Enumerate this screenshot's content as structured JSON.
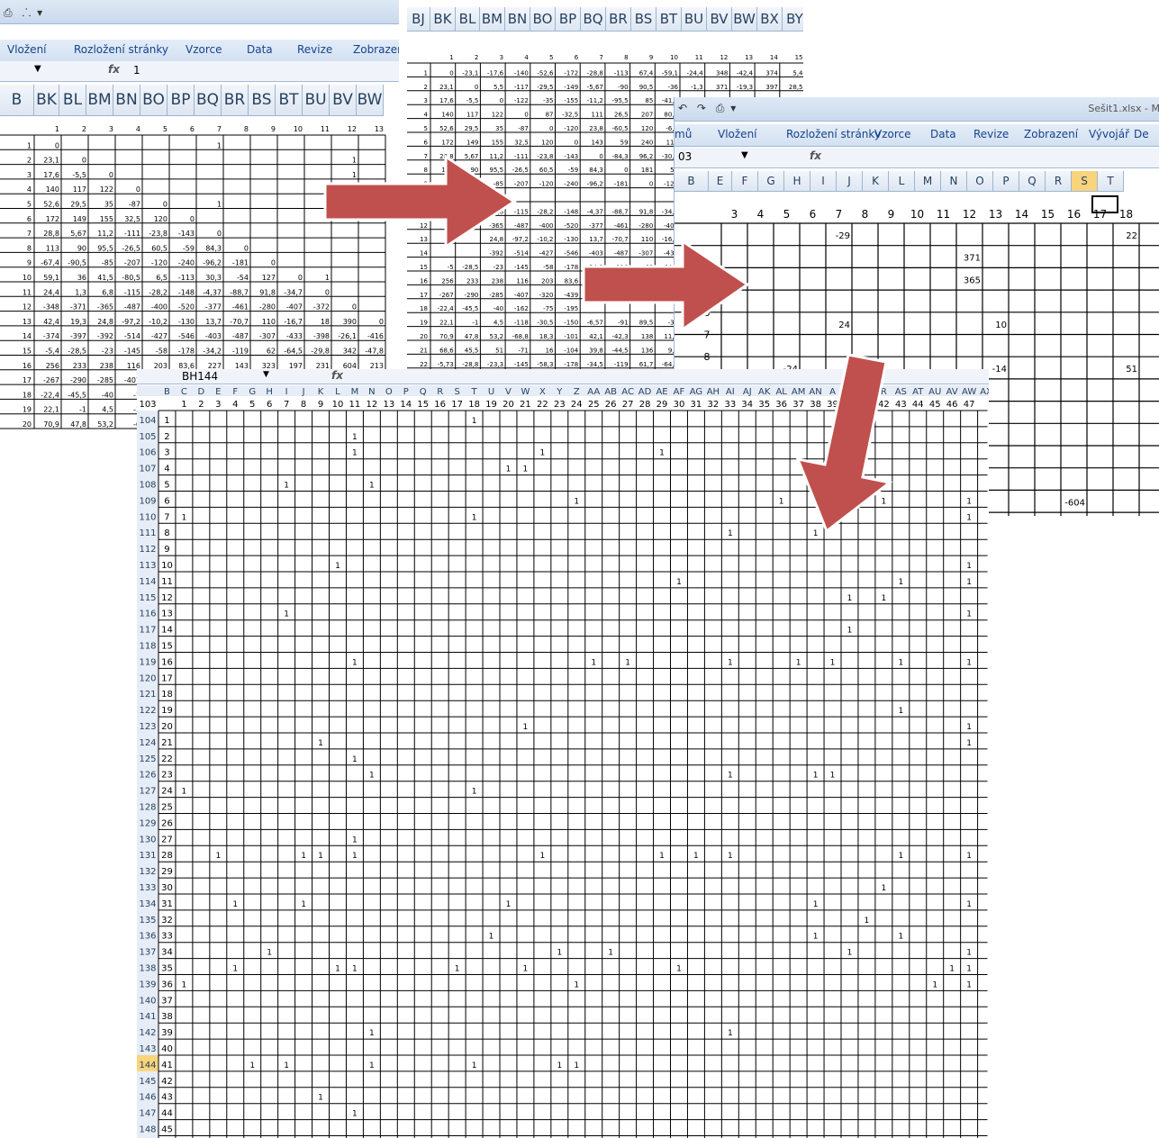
{
  "win_left": {
    "qat_arrow": "▾",
    "tabs": [
      "Vložení",
      "Rozložení stránky",
      "Vzorce",
      "Data",
      "Revize",
      "Zobrazen"
    ],
    "formula_value": "1",
    "fx": "fx",
    "col_headers": [
      "B",
      "BK",
      "BL",
      "BM",
      "BN",
      "BO",
      "BP",
      "BQ",
      "BR",
      "BS",
      "BT",
      "BU",
      "BV",
      "BW"
    ],
    "sub_headers": [
      "1",
      "2",
      "3",
      "4",
      "5",
      "6",
      "7",
      "8",
      "9",
      "10",
      "11",
      "12",
      "13"
    ],
    "rows": [
      {
        "n": "1",
        "v": [
          "0",
          "",
          "",
          "",
          "",
          "",
          "1",
          "",
          "",
          "",
          "",
          "",
          ""
        ]
      },
      {
        "n": "2",
        "v": [
          "23,1",
          "0",
          "",
          "",
          "",
          "",
          "",
          "",
          "",
          "",
          "",
          "1",
          ""
        ]
      },
      {
        "n": "3",
        "v": [
          "17,6",
          "-5,5",
          "0",
          "",
          "",
          "",
          "",
          "",
          "",
          "",
          "",
          "1",
          ""
        ]
      },
      {
        "n": "4",
        "v": [
          "140",
          "117",
          "122",
          "0",
          "",
          "",
          "",
          "",
          "",
          "",
          "",
          "",
          ""
        ]
      },
      {
        "n": "5",
        "v": [
          "52,6",
          "29,5",
          "35",
          "-87",
          "0",
          "",
          "1",
          "",
          "",
          "",
          "",
          "",
          ""
        ]
      },
      {
        "n": "6",
        "v": [
          "172",
          "149",
          "155",
          "32,5",
          "120",
          "0",
          "",
          "",
          "",
          "",
          "",
          "",
          ""
        ]
      },
      {
        "n": "7",
        "v": [
          "28,8",
          "5,67",
          "11,2",
          "-111",
          "-23,8",
          "-143",
          "0",
          "",
          "",
          "",
          "",
          "",
          ""
        ]
      },
      {
        "n": "8",
        "v": [
          "113",
          "90",
          "95,5",
          "-26,5",
          "60,5",
          "-59",
          "84,3",
          "0",
          "",
          "",
          "",
          "",
          ""
        ]
      },
      {
        "n": "9",
        "v": [
          "-67,4",
          "-90,5",
          "-85",
          "-207",
          "-120",
          "-240",
          "-96,2",
          "-181",
          "0",
          "",
          "",
          "",
          ""
        ]
      },
      {
        "n": "10",
        "v": [
          "59,1",
          "36",
          "41,5",
          "-80,5",
          "6,5",
          "-113",
          "30,3",
          "-54",
          "127",
          "0",
          "1",
          "",
          ""
        ]
      },
      {
        "n": "11",
        "v": [
          "24,4",
          "1,3",
          "6,8",
          "-115",
          "-28,2",
          "-148",
          "-4,37",
          "-88,7",
          "91,8",
          "-34,7",
          "0",
          "",
          ""
        ]
      },
      {
        "n": "12",
        "v": [
          "-348",
          "-371",
          "-365",
          "-487",
          "-400",
          "-520",
          "-377",
          "-461",
          "-280",
          "-407",
          "-372",
          "0",
          ""
        ]
      },
      {
        "n": "13",
        "v": [
          "42,4",
          "19,3",
          "24,8",
          "-97,2",
          "-10,2",
          "-130",
          "13,7",
          "-70,7",
          "110",
          "-16,7",
          "18",
          "390",
          "0"
        ]
      },
      {
        "n": "14",
        "v": [
          "-374",
          "-397",
          "-392",
          "-514",
          "-427",
          "-546",
          "-403",
          "-487",
          "-307",
          "-433",
          "-398",
          "-26,1",
          "-416"
        ]
      },
      {
        "n": "15",
        "v": [
          "-5,4",
          "-28,5",
          "-23",
          "-145",
          "-58",
          "-178",
          "-34,2",
          "-119",
          "62",
          "-64,5",
          "-29,8",
          "342",
          "-47,8"
        ]
      },
      {
        "n": "16",
        "v": [
          "256",
          "233",
          "238",
          "116",
          "203",
          "83,6",
          "227",
          "143",
          "323",
          "197",
          "231",
          "604",
          "213"
        ]
      },
      {
        "n": "17",
        "v": [
          "-267",
          "-290",
          "-285",
          "-407",
          "",
          "",
          "",
          "",
          "",
          "",
          "",
          "",
          ""
        ]
      },
      {
        "n": "18",
        "v": [
          "-22,4",
          "-45,5",
          "-40",
          "-1",
          "",
          "",
          "",
          "",
          "",
          "",
          "",
          "",
          ""
        ]
      },
      {
        "n": "19",
        "v": [
          "22,1",
          "-1",
          "4,5",
          "-1",
          "",
          "",
          "",
          "",
          "",
          "",
          "",
          "",
          ""
        ]
      },
      {
        "n": "20",
        "v": [
          "70,9",
          "47,8",
          "53,2",
          "-6",
          "",
          "",
          "",
          "",
          "",
          "",
          "",
          "",
          ""
        ]
      }
    ]
  },
  "win_mid": {
    "col_headers": [
      "BJ",
      "BK",
      "BL",
      "BM",
      "BN",
      "BO",
      "BP",
      "BQ",
      "BR",
      "BS",
      "BT",
      "BU",
      "BV",
      "BW",
      "BX",
      "BY"
    ],
    "sub_headers": [
      "1",
      "2",
      "3",
      "4",
      "5",
      "6",
      "7",
      "8",
      "9",
      "10",
      "11",
      "12",
      "13",
      "14",
      "15"
    ],
    "rows": [
      {
        "n": "1",
        "v": [
          "0",
          "-23,1",
          "-17,6",
          "-140",
          "-52,6",
          "-172",
          "-28,8",
          "-113",
          "67,4",
          "-59,1",
          "-24,4",
          "348",
          "-42,4",
          "374",
          "5,4"
        ]
      },
      {
        "n": "2",
        "v": [
          "23,1",
          "0",
          "5,5",
          "-117",
          "-29,5",
          "-149",
          "-5,67",
          "-90",
          "90,5",
          "-36",
          "-1,3",
          "371",
          "-19,3",
          "397",
          "28,5"
        ]
      },
      {
        "n": "3",
        "v": [
          "17,6",
          "-5,5",
          "0",
          "-122",
          "-35",
          "-155",
          "-11,2",
          "-95,5",
          "85",
          "-41,5",
          "-6,8",
          "365",
          "-24,8",
          "392",
          "23"
        ]
      },
      {
        "n": "4",
        "v": [
          "140",
          "117",
          "122",
          "0",
          "87",
          "-32,5",
          "111",
          "26,5",
          "207",
          "80,5",
          "",
          "",
          "",
          "",
          ""
        ]
      },
      {
        "n": "5",
        "v": [
          "52,6",
          "29,5",
          "35",
          "-87",
          "0",
          "-120",
          "23,8",
          "-60,5",
          "120",
          "-6,5",
          "",
          "",
          "",
          "",
          ""
        ]
      },
      {
        "n": "6",
        "v": [
          "172",
          "149",
          "155",
          "32,5",
          "120",
          "0",
          "143",
          "59",
          "240",
          "113",
          "",
          "",
          "",
          "",
          ""
        ]
      },
      {
        "n": "7",
        "v": [
          "28,8",
          "5,67",
          "11,2",
          "-111",
          "-23,8",
          "-143",
          "0",
          "-84,3",
          "96,2",
          "-30,3",
          "",
          "",
          "",
          "",
          ""
        ]
      },
      {
        "n": "8",
        "v": [
          "113",
          "90",
          "95,5",
          "-26,5",
          "60,5",
          "-59",
          "84,3",
          "0",
          "181",
          "54",
          "",
          "",
          "",
          "",
          ""
        ]
      },
      {
        "n": "9",
        "v": [
          "-67",
          "-90,5",
          "-85",
          "-207",
          "-120",
          "-240",
          "-96,2",
          "-181",
          "0",
          "-127",
          "",
          "",
          "",
          "",
          ""
        ]
      },
      {
        "n": "10",
        "v": [
          "",
          "",
          "",
          "",
          "",
          "",
          "",
          "",
          "",
          "",
          "",
          "",
          "",
          "",
          ""
        ]
      },
      {
        "n": "11",
        "v": [
          "",
          "",
          "6,8",
          "-115",
          "-28,2",
          "-148",
          "-4,37",
          "-88,7",
          "91,8",
          "-34,7",
          "",
          "",
          "",
          "",
          ""
        ]
      },
      {
        "n": "12",
        "v": [
          "",
          "",
          "-365",
          "-487",
          "-400",
          "-520",
          "-377",
          "-461",
          "-280",
          "-407",
          "",
          "",
          "",
          "",
          ""
        ]
      },
      {
        "n": "13",
        "v": [
          "",
          "",
          "24,8",
          "-97,2",
          "-10,2",
          "-130",
          "13,7",
          "-70,7",
          "110",
          "-16,7",
          "",
          "",
          "",
          "",
          ""
        ]
      },
      {
        "n": "14",
        "v": [
          "",
          "",
          "-392",
          "-514",
          "-427",
          "-546",
          "-403",
          "-487",
          "-307",
          "-433",
          "",
          "",
          "",
          "",
          ""
        ]
      },
      {
        "n": "15",
        "v": [
          "-5",
          "-28,5",
          "-23",
          "-145",
          "-58",
          "-178",
          "-34,2",
          "-119",
          "62",
          "-64,5",
          "",
          "",
          "",
          "",
          ""
        ]
      },
      {
        "n": "16",
        "v": [
          "256",
          "233",
          "238",
          "116",
          "203",
          "83,6",
          "",
          "",
          "",
          "",
          "",
          "",
          "",
          "",
          ""
        ]
      },
      {
        "n": "17",
        "v": [
          "-267",
          "-290",
          "-285",
          "-407",
          "-320",
          "-439",
          "",
          "",
          "",
          "",
          "",
          "",
          "",
          "",
          ""
        ]
      },
      {
        "n": "18",
        "v": [
          "-22,4",
          "-45,5",
          "-40",
          "-162",
          "-75",
          "-195",
          "",
          "",
          "",
          "",
          "",
          "",
          "",
          "",
          ""
        ]
      },
      {
        "n": "19",
        "v": [
          "22,1",
          "-1",
          "4,5",
          "-118",
          "-30,5",
          "-150",
          "-6,57",
          "-91",
          "89,5",
          "-37",
          "",
          "",
          "",
          "",
          ""
        ]
      },
      {
        "n": "20",
        "v": [
          "70,9",
          "47,8",
          "53,2",
          "-68,8",
          "18,3",
          "-101",
          "42,1",
          "-42,3",
          "138",
          "11,8",
          "",
          "",
          "",
          "",
          ""
        ]
      },
      {
        "n": "21",
        "v": [
          "68,6",
          "45,5",
          "51",
          "-71",
          "16",
          "-104",
          "39,8",
          "-44,5",
          "136",
          "9,5",
          "",
          "",
          "",
          "",
          ""
        ]
      },
      {
        "n": "22",
        "v": [
          "-5,73",
          "-28,8",
          "-23,3",
          "-145",
          "-58,3",
          "-178",
          "-34,5",
          "-119",
          "61,7",
          "-64,8",
          "",
          "",
          "",
          "",
          ""
        ]
      },
      {
        "n": "23",
        "v": [
          "77,5",
          "54,4",
          "59,9",
          "-62,1",
          "24,9",
          "-94,6",
          "48,7",
          "-35,6",
          "145",
          "18,4",
          "",
          "",
          "",
          "",
          ""
        ]
      },
      {
        "n": "24",
        "v": [
          "14",
          "-9,1",
          "-3,6",
          "-126",
          "-38,6",
          "-158",
          "-14,8",
          "-99,1",
          "81,4",
          "-45,1",
          "",
          "",
          "",
          "",
          ""
        ]
      }
    ]
  },
  "win_right": {
    "qat_arrow": "▾",
    "title": "Sešit1.xlsx - M",
    "tabs": [
      "mů",
      "Vložení",
      "Rozložení stránky",
      "Vzorce",
      "Data",
      "Revize",
      "Zobrazení",
      "Vývojář",
      "De"
    ],
    "namebox": "03",
    "fx": "fx",
    "col_headers": [
      "B",
      "E",
      "F",
      "G",
      "H",
      "I",
      "J",
      "K",
      "L",
      "M",
      "N",
      "O",
      "P",
      "Q",
      "R",
      "S",
      "T"
    ],
    "sub_headers": [
      "3",
      "4",
      "5",
      "6",
      "7",
      "8",
      "9",
      "10",
      "11",
      "12",
      "13",
      "14",
      "15",
      "16",
      "17",
      "18"
    ],
    "row_labels": [
      "6",
      "7",
      "8"
    ],
    "values": [
      {
        "t": "-29",
        "c": 4,
        "r": 0
      },
      {
        "t": "22",
        "c": 15,
        "r": 0
      },
      {
        "t": "371",
        "c": 9,
        "r": 1
      },
      {
        "t": "365",
        "c": 9,
        "r": 2
      },
      {
        "t": "24",
        "c": 4,
        "r": 4
      },
      {
        "t": "10",
        "c": 10,
        "r": 4
      },
      {
        "t": "-24",
        "c": 2,
        "r": 6
      },
      {
        "t": "-14",
        "c": 10,
        "r": 6
      },
      {
        "t": "51",
        "c": 15,
        "r": 6
      },
      {
        "t": "-604",
        "c": 13,
        "r": 12
      }
    ]
  },
  "win_front": {
    "namebox": "BH144",
    "fx": "fx",
    "row0_label": "103",
    "col_letters": [
      "B",
      "C",
      "D",
      "E",
      "F",
      "G",
      "H",
      "I",
      "J",
      "K",
      "L",
      "M",
      "N",
      "O",
      "P",
      "Q",
      "R",
      "S",
      "T",
      "U",
      "V",
      "W",
      "X",
      "Y",
      "Z",
      "AA",
      "AB",
      "AC",
      "AD",
      "AE",
      "AF",
      "AG",
      "AH",
      "AI",
      "AJ",
      "AK",
      "AL",
      "AM",
      "AN",
      "A",
      "",
      "",
      "R",
      "AS",
      "AT",
      "AU",
      "AV",
      "AW",
      "AX"
    ],
    "row_numbers": [
      "104",
      "105",
      "106",
      "107",
      "108",
      "109",
      "110",
      "111",
      "112",
      "113",
      "114",
      "115",
      "116",
      "117",
      "118",
      "119",
      "120",
      "121",
      "122",
      "123",
      "124",
      "125",
      "126",
      "127",
      "128",
      "129",
      "130",
      "131",
      "132",
      "133",
      "134",
      "135",
      "136",
      "137",
      "138",
      "139",
      "140",
      "141",
      "142",
      "143",
      "144",
      "145",
      "146",
      "147",
      "148",
      "149",
      "150"
    ],
    "ones": [
      [
        17
      ],
      [
        10,
        38
      ],
      [
        10,
        21,
        28
      ],
      [
        19,
        20
      ],
      [
        6,
        11
      ],
      [
        23,
        35,
        41,
        46
      ],
      [
        0,
        17,
        46
      ],
      [
        32,
        37
      ],
      [],
      [
        9,
        46
      ],
      [
        29,
        42,
        46
      ],
      [
        39,
        41
      ],
      [
        6,
        46
      ],
      [
        39
      ],
      [],
      [
        10,
        24,
        26,
        32,
        36,
        38,
        42,
        46
      ],
      [],
      [],
      [
        42
      ],
      [
        20,
        46
      ],
      [
        8,
        46
      ],
      [
        10
      ],
      [
        11,
        32,
        37,
        38
      ],
      [
        0,
        17
      ],
      [],
      [],
      [
        10
      ],
      [
        2,
        7,
        8,
        10,
        21,
        28,
        30,
        32,
        42,
        46
      ],
      [],
      [
        41
      ],
      [
        3,
        7,
        19,
        37,
        46
      ],
      [
        40
      ],
      [
        18,
        37,
        42
      ],
      [
        5,
        22,
        25,
        39,
        46
      ],
      [
        3,
        9,
        10,
        16,
        20,
        29,
        45,
        46
      ],
      [
        0,
        23,
        44,
        46
      ],
      [],
      [],
      [
        11,
        32
      ],
      [],
      [
        4,
        6,
        11,
        17,
        22,
        23
      ],
      [],
      [
        8
      ],
      [
        10
      ],
      [],
      [
        3,
        22,
        25,
        37,
        46
      ],
      [
        0,
        2,
        10,
        12,
        13,
        16,
        25,
        26,
        27,
        28,
        29,
        30,
        31,
        38,
        40,
        41,
        43
      ]
    ],
    "highlight_row": "144"
  },
  "arrows": {
    "color": "#c0504d"
  }
}
